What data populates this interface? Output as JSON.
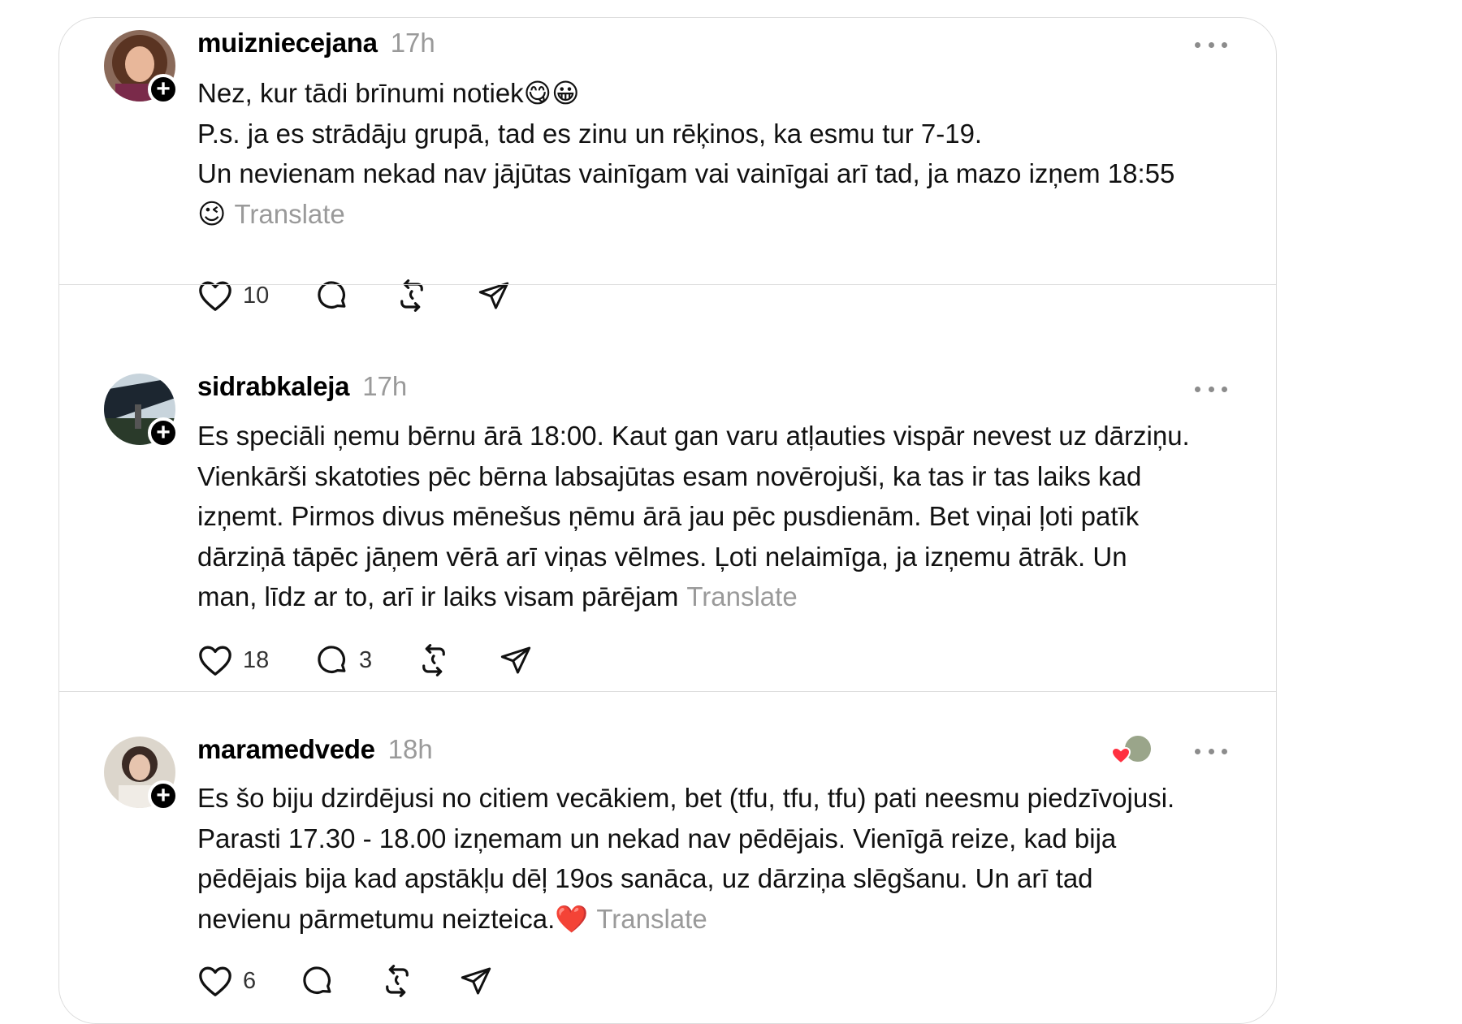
{
  "posts": [
    {
      "username": "muizniecejana",
      "time": "17h",
      "lines": [
        "Nez, kur tādi brīnumi notiek😋😀",
        "P.s. ja es strādāju grupā, tad es zinu un rēķinos, ka esmu tur 7-19.",
        "Un nevienam nekad nav jājūtas vainīgam vai vainīgai arī tad, ja mazo izņem 18:55"
      ],
      "last_line": "😉",
      "translate": "Translate",
      "likes": "10",
      "replies": ""
    },
    {
      "username": "sidrabkaleja",
      "time": "17h",
      "lines": [
        "Es speciāli ņemu bērnu ārā 18:00. Kaut gan varu atļauties vispār nevest uz dārziņu.",
        "Vienkārši skatoties pēc bērna labsajūtas esam novērojuši, ka tas ir tas laiks kad",
        "izņemt. Pirmos divus mēnešus ņēmu ārā jau pēc pusdienām. Bet viņai ļoti patīk",
        "dārziņā tāpēc jāņem vērā arī viņas vēlmes. Ļoti nelaimīga, ja izņemu ātrāk. Un"
      ],
      "last_line": "man, līdz ar to, arī ir laiks visam pārējam",
      "translate": "Translate",
      "likes": "18",
      "replies": "3"
    },
    {
      "username": "maramedvede",
      "time": "18h",
      "lines": [
        "Es šo biju dzirdējusi no citiem vecākiem, bet (tfu, tfu, tfu) pati neesmu piedzīvojusi.",
        "Parasti 17.30 - 18.00 izņemam un nekad nav pēdējais. Vienīgā reize, kad bija",
        "pēdējais bija kad apstākļu dēļ 19os sanāca, uz dārziņa slēgšanu. Un arī tad"
      ],
      "last_line": "nevienu pārmetumu neizteica.❤️",
      "translate": "Translate",
      "likes": "6",
      "replies": ""
    }
  ],
  "icons": {
    "like": "heart-icon",
    "reply": "comment-icon",
    "repost": "repost-icon",
    "share": "send-icon",
    "more": "more-icon",
    "follow": "plus-icon"
  },
  "colors": {
    "muted": "#9a9a9a",
    "border": "#dcdcdc",
    "reaction_heart": "#ff3040"
  }
}
